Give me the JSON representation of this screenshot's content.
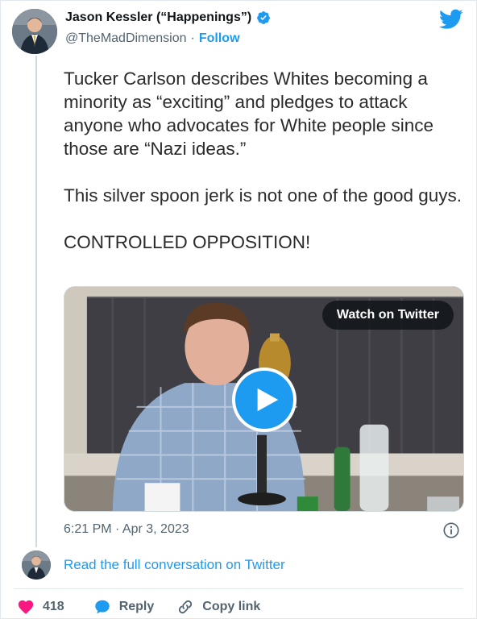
{
  "header": {
    "display_name": "Jason Kessler (“Happenings”)",
    "handle": "@TheMadDimension",
    "separator": "·",
    "follow_label": "Follow",
    "verified_icon": "verified-badge-icon",
    "brand_icon": "twitter-bird-icon"
  },
  "tweet": {
    "paragraphs": [
      "Tucker Carlson describes Whites becoming a minority as “exciting” and pledges to attack anyone who advocates for White people since those are “Nazi ideas.”",
      "This silver spoon jerk is not one of the good guys.",
      "CONTROLLED OPPOSITION!"
    ]
  },
  "media": {
    "watch_label": "Watch on Twitter",
    "play_icon": "play-icon"
  },
  "meta": {
    "timestamp": "6:21 PM · Apr 3, 2023",
    "info_icon": "info-icon"
  },
  "conversation": {
    "read_link": "Read the full conversation on Twitter"
  },
  "actions": {
    "like_count": "418",
    "reply_label": "Reply",
    "copy_label": "Copy link"
  },
  "colors": {
    "accent": "#1d9bf0",
    "like": "#f91880",
    "text_muted": "#536471",
    "text": "#0f1419"
  }
}
